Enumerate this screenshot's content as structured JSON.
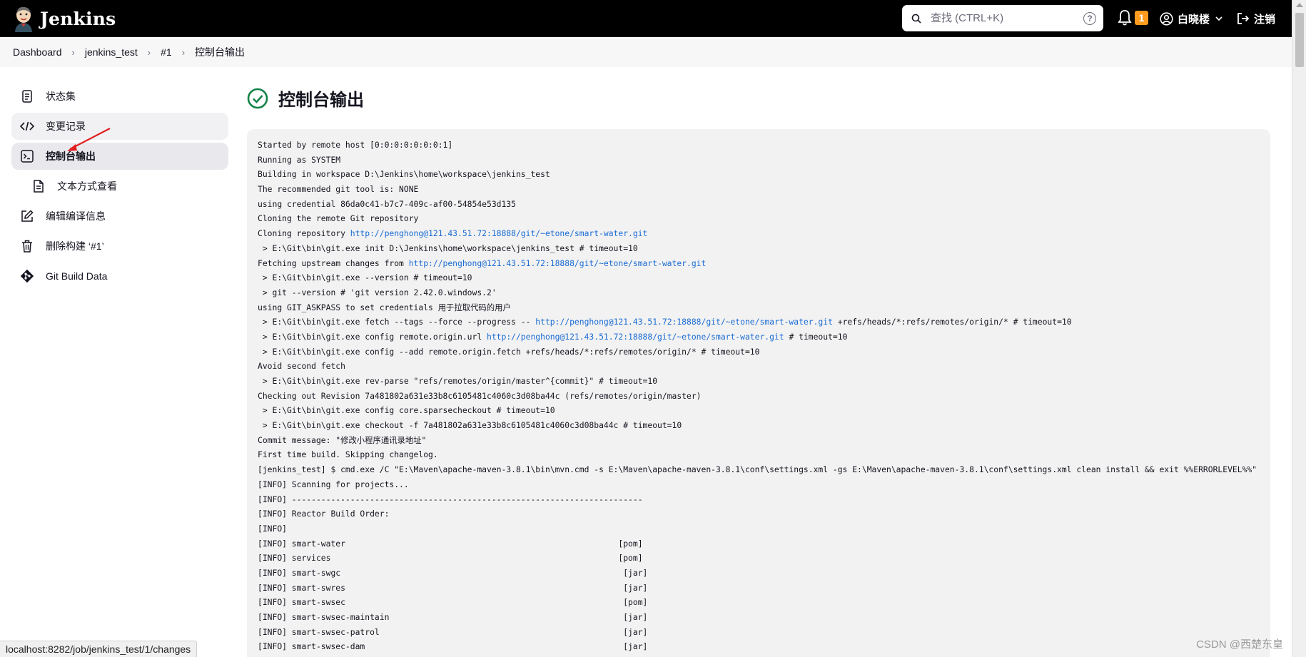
{
  "header": {
    "app_name": "Jenkins",
    "search_placeholder": "查找 (CTRL+K)",
    "help_label": "?",
    "notification_count": "1",
    "user_name": "白晓楼",
    "logout_label": "注销",
    "colors": {
      "bar": "#000000",
      "badge": "#fe9a1e"
    }
  },
  "breadcrumbs": [
    "Dashboard",
    "jenkins_test",
    "#1",
    "控制台输出"
  ],
  "sidebar": {
    "items": [
      {
        "label": "状态集",
        "icon": "document-icon"
      },
      {
        "label": "变更记录",
        "icon": "code-icon"
      },
      {
        "label": "控制台输出",
        "icon": "terminal-icon"
      },
      {
        "label": "文本方式查看",
        "icon": "file-text-icon"
      },
      {
        "label": "编辑编译信息",
        "icon": "edit-icon"
      },
      {
        "label": "删除构建 ‘#1’",
        "icon": "trash-icon"
      },
      {
        "label": "Git Build Data",
        "icon": "git-icon"
      }
    ]
  },
  "main": {
    "title": "控制台输出",
    "status_icon": "success-check-icon",
    "link_color": "#1b6cd4",
    "console_lines": [
      {
        "text": "Started by remote host [0:0:0:0:0:0:0:1]"
      },
      {
        "text": "Running as SYSTEM"
      },
      {
        "text": "Building in workspace D:\\Jenkins\\home\\workspace\\jenkins_test"
      },
      {
        "text": "The recommended git tool is: NONE"
      },
      {
        "text": "using credential 86da0c41-b7c7-409c-af00-54854e53d135"
      },
      {
        "text": "Cloning the remote Git repository"
      },
      {
        "text": "Cloning repository ",
        "link": "http://penghong@121.43.51.72:18888/git/~etone/smart-water.git",
        "after": ""
      },
      {
        "text": " > E:\\Git\\bin\\git.exe init D:\\Jenkins\\home\\workspace\\jenkins_test # timeout=10"
      },
      {
        "text": "Fetching upstream changes from ",
        "link": "http://penghong@121.43.51.72:18888/git/~etone/smart-water.git",
        "after": ""
      },
      {
        "text": " > E:\\Git\\bin\\git.exe --version # timeout=10"
      },
      {
        "text": " > git --version # 'git version 2.42.0.windows.2'"
      },
      {
        "text": "using GIT_ASKPASS to set credentials 用于拉取代码的用户"
      },
      {
        "text": " > E:\\Git\\bin\\git.exe fetch --tags --force --progress -- ",
        "link": "http://penghong@121.43.51.72:18888/git/~etone/smart-water.git",
        "after": " +refs/heads/*:refs/remotes/origin/* # timeout=10"
      },
      {
        "text": " > E:\\Git\\bin\\git.exe config remote.origin.url ",
        "link": "http://penghong@121.43.51.72:18888/git/~etone/smart-water.git",
        "after": " # timeout=10"
      },
      {
        "text": " > E:\\Git\\bin\\git.exe config --add remote.origin.fetch +refs/heads/*:refs/remotes/origin/* # timeout=10"
      },
      {
        "text": "Avoid second fetch"
      },
      {
        "text": " > E:\\Git\\bin\\git.exe rev-parse \"refs/remotes/origin/master^{commit}\" # timeout=10"
      },
      {
        "text": "Checking out Revision 7a481802a631e33b8c6105481c4060c3d08ba44c (refs/remotes/origin/master)"
      },
      {
        "text": " > E:\\Git\\bin\\git.exe config core.sparsecheckout # timeout=10"
      },
      {
        "text": " > E:\\Git\\bin\\git.exe checkout -f 7a481802a631e33b8c6105481c4060c3d08ba44c # timeout=10"
      },
      {
        "text": "Commit message: \"修改小程序通讯录地址\""
      },
      {
        "text": "First time build. Skipping changelog."
      },
      {
        "text": "[jenkins_test] $ cmd.exe /C \"E:\\Maven\\apache-maven-3.8.1\\bin\\mvn.cmd -s E:\\Maven\\apache-maven-3.8.1\\conf\\settings.xml -gs E:\\Maven\\apache-maven-3.8.1\\conf\\settings.xml clean install && exit %%ERRORLEVEL%%\""
      },
      {
        "text": "[INFO] Scanning for projects..."
      },
      {
        "text": "[INFO] ------------------------------------------------------------------------"
      },
      {
        "text": "[INFO] Reactor Build Order:"
      },
      {
        "text": "[INFO]"
      },
      {
        "text": "[INFO] smart-water                                                        [pom]"
      },
      {
        "text": "[INFO] services                                                           [pom]"
      },
      {
        "text": "[INFO] smart-swgc                                                          [jar]"
      },
      {
        "text": "[INFO] smart-swres                                                         [jar]"
      },
      {
        "text": "[INFO] smart-swsec                                                         [pom]"
      },
      {
        "text": "[INFO] smart-swsec-maintain                                                [jar]"
      },
      {
        "text": "[INFO] smart-swsec-patrol                                                  [jar]"
      },
      {
        "text": "[INFO] smart-swsec-dam                                                     [jar]"
      }
    ]
  },
  "status_bar": {
    "url": "localhost:8282/job/jenkins_test/1/changes"
  },
  "watermark": "CSDN @西楚东皇"
}
